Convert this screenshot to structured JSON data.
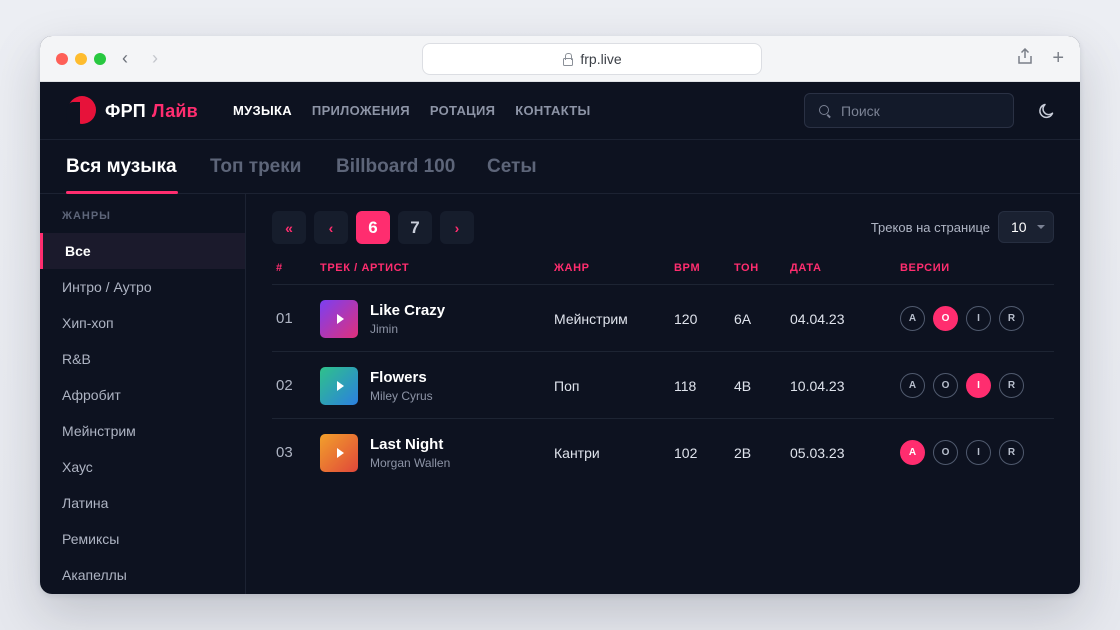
{
  "browser": {
    "url": "frp.live"
  },
  "app": {
    "logo_name": "ФРП",
    "logo_accent": "Лайв",
    "nav": [
      "МУЗЫКА",
      "ПРИЛОЖЕНИЯ",
      "РОТАЦИЯ",
      "КОНТАКТЫ"
    ],
    "nav_active": "МУЗЫКА",
    "search_placeholder": "Поиск",
    "accent_color": "#ff2d6f"
  },
  "tabs": [
    "Вся музыка",
    "Топ треки",
    "Billboard 100",
    "Сеты"
  ],
  "tab_active": "Вся музыка",
  "sidebar": {
    "title": "ЖАНРЫ",
    "genres": [
      "Все",
      "Интро / Аутро",
      "Хип-хоп",
      "R&B",
      "Афробит",
      "Мейнстрим",
      "Хаус",
      "Латина",
      "Ремиксы",
      "Акапеллы"
    ],
    "active": "Все"
  },
  "pagination": {
    "first": "«",
    "prev": "‹",
    "pages": [
      "6",
      "7"
    ],
    "current": "6",
    "next": "›"
  },
  "per_page": {
    "label": "Треков на странице",
    "value": "10"
  },
  "table": {
    "headers": [
      "#",
      "ТРЕК / АРТИСТ",
      "ЖАНР",
      "BPM",
      "ТОН",
      "ДАТА",
      "ВЕРСИИ"
    ],
    "version_labels": [
      "A",
      "O",
      "I",
      "R"
    ],
    "rows": [
      {
        "num": "01",
        "title": "Like Crazy",
        "artist": "Jimin",
        "genre": "Мейнстрим",
        "bpm": "120",
        "key": "6A",
        "date": "04.04.23",
        "active_version": "O"
      },
      {
        "num": "02",
        "title": "Flowers",
        "artist": "Miley Cyrus",
        "genre": "Поп",
        "bpm": "118",
        "key": "4B",
        "date": "10.04.23",
        "active_version": "I"
      },
      {
        "num": "03",
        "title": "Last Night",
        "artist": "Morgan Wallen",
        "genre": "Кантри",
        "bpm": "102",
        "key": "2B",
        "date": "05.03.23",
        "active_version": "A"
      }
    ]
  }
}
